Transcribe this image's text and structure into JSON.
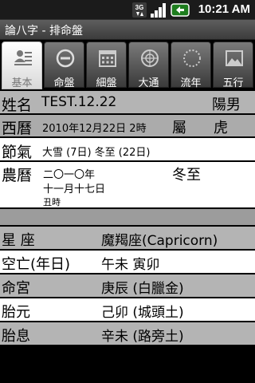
{
  "status": {
    "time": "10:21 AM",
    "network": "3G"
  },
  "app": {
    "title": "論八字 - 排命盤"
  },
  "tabs": [
    {
      "label": "基本",
      "icon": "profile-icon",
      "active": true
    },
    {
      "label": "命盤",
      "icon": "circle-minus-icon"
    },
    {
      "label": "細盤",
      "icon": "calendar-grid-icon"
    },
    {
      "label": "大通",
      "icon": "compass-icon"
    },
    {
      "label": "流年",
      "icon": "dotted-circle-icon"
    },
    {
      "label": "五行",
      "icon": "picture-icon"
    }
  ],
  "profile": {
    "name_label": "姓名",
    "name": "TEST.12.22",
    "gender": "陽男",
    "solar_label": "西曆",
    "solar_date": "2010年12月22日 2時",
    "zodiac_label": "屬",
    "zodiac": "虎",
    "term_label": "節氣",
    "terms": "大雪 (7日) 冬至 (22日)",
    "lunar_label": "農曆",
    "lunar_year": "二〇一〇年",
    "lunar_month_day": "十一月十七日",
    "lunar_hour": "丑時",
    "lunar_term": "冬至"
  },
  "details": [
    {
      "label": "星 座",
      "value": "魔羯座(Capricorn)"
    },
    {
      "label": "空亡(年日)",
      "value": "午未 寅卯"
    },
    {
      "label": "命宮",
      "value": "庚辰 (白臘金)"
    },
    {
      "label": "胎元",
      "value": "己卯 (城頭土)"
    },
    {
      "label": "胎息",
      "value": "辛未 (路旁土)"
    }
  ]
}
